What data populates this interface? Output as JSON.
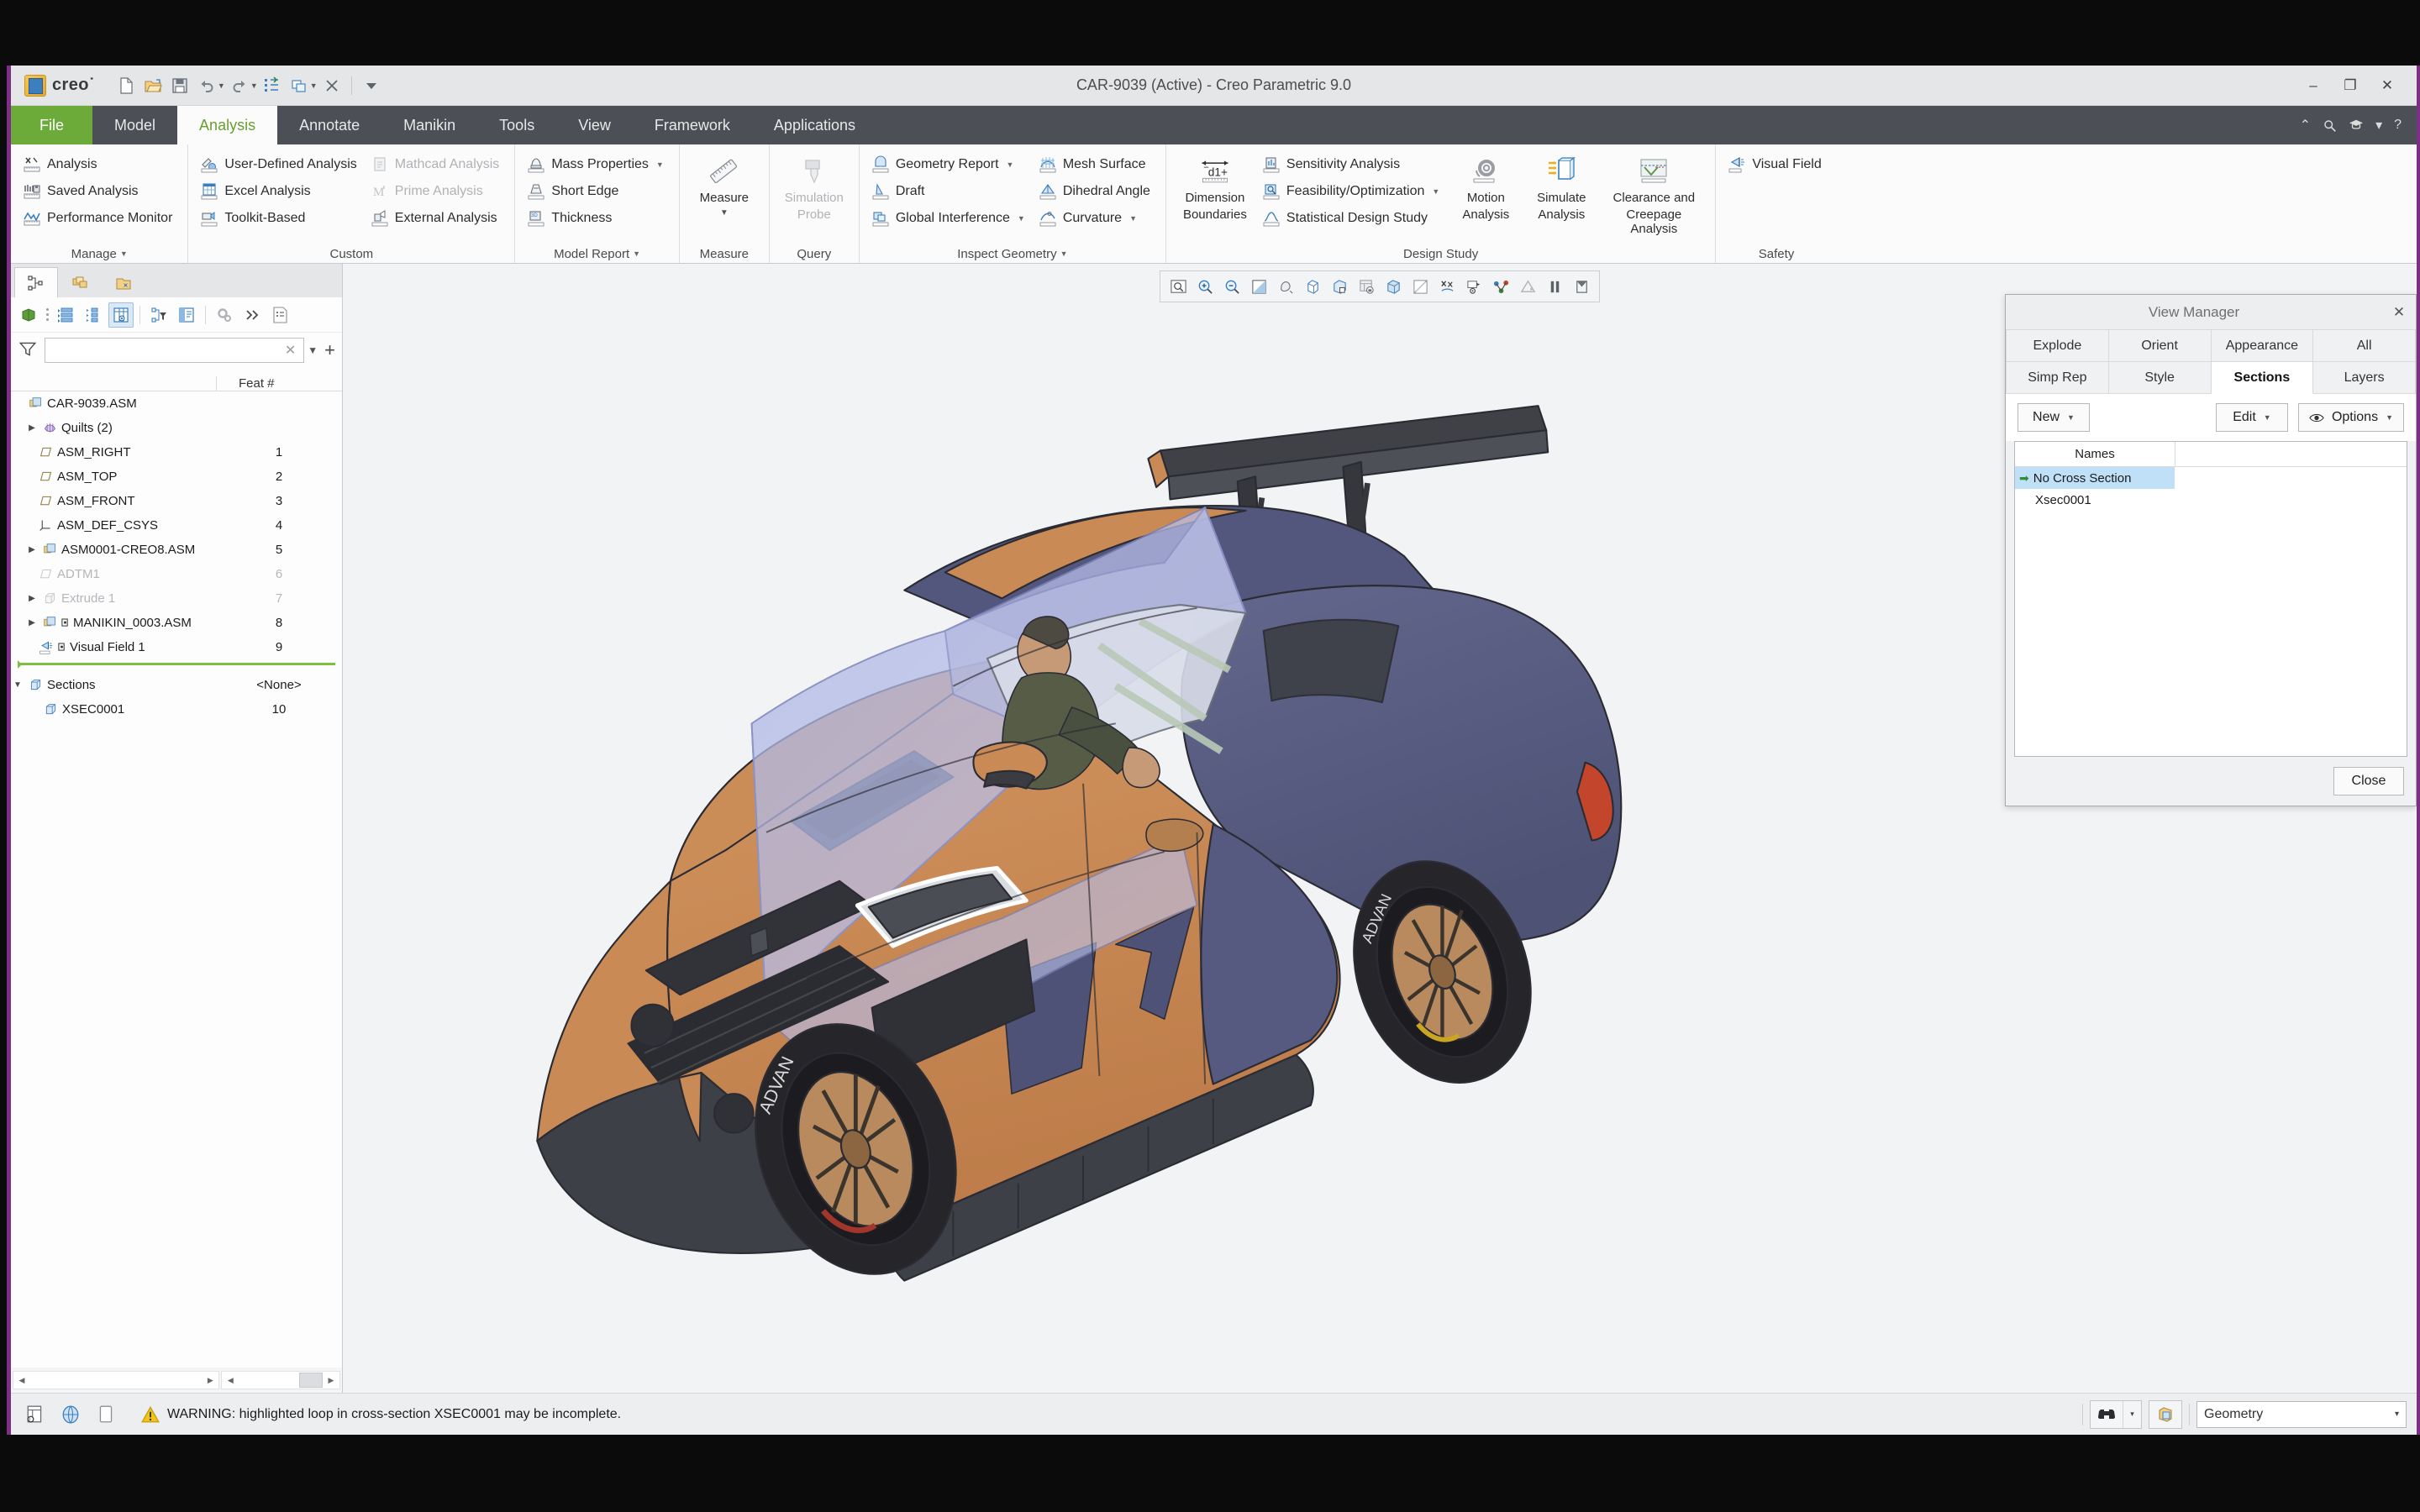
{
  "window": {
    "title": "CAR-9039 (Active) - Creo Parametric 9.0",
    "minimize": "–",
    "restore": "❐",
    "close": "✕"
  },
  "brand": {
    "name": "creo˙"
  },
  "quick_access": [
    {
      "name": "new-file-icon",
      "tip": "New"
    },
    {
      "name": "open-file-icon",
      "tip": "Open"
    },
    {
      "name": "save-icon",
      "tip": "Save"
    },
    {
      "name": "undo-icon",
      "tip": "Undo"
    },
    {
      "name": "redo-icon",
      "tip": "Redo"
    },
    {
      "name": "regenerate-icon",
      "tip": "Regenerate"
    },
    {
      "name": "window-switch-icon",
      "tip": "Switch Window"
    },
    {
      "name": "close-window-icon",
      "tip": "Close"
    },
    {
      "name": "customize-qat-icon",
      "tip": "Customize Quick Access Toolbar"
    }
  ],
  "tabs": [
    {
      "label": "File",
      "kind": "file"
    },
    {
      "label": "Model",
      "kind": "normal"
    },
    {
      "label": "Analysis",
      "kind": "active"
    },
    {
      "label": "Annotate",
      "kind": "normal"
    },
    {
      "label": "Manikin",
      "kind": "normal"
    },
    {
      "label": "Tools",
      "kind": "normal"
    },
    {
      "label": "View",
      "kind": "normal"
    },
    {
      "label": "Framework",
      "kind": "normal"
    },
    {
      "label": "Applications",
      "kind": "normal"
    }
  ],
  "tabrow_right": [
    {
      "name": "collapse-ribbon-icon",
      "glyph": "⌃"
    },
    {
      "name": "search-icon",
      "glyph": "⌕"
    },
    {
      "name": "learning-icon",
      "glyph": "🎓"
    },
    {
      "name": "learning-dropdown-icon",
      "glyph": "▾"
    },
    {
      "name": "help-icon",
      "glyph": "?"
    }
  ],
  "ribbon": {
    "groups": [
      {
        "title": "Manage",
        "has_dropdown": true,
        "items": [
          {
            "label": "Analysis",
            "icon": "analysis-icon",
            "disabled": false,
            "dropdown": false
          },
          {
            "label": "Saved Analysis",
            "icon": "saved-analysis-icon",
            "disabled": false,
            "dropdown": false
          },
          {
            "label": "Performance Monitor",
            "icon": "performance-monitor-icon",
            "disabled": false,
            "dropdown": false
          }
        ]
      },
      {
        "title": "Custom",
        "has_dropdown": false,
        "columns": [
          [
            {
              "label": "User-Defined Analysis",
              "icon": "user-defined-analysis-icon",
              "disabled": false,
              "dropdown": false
            },
            {
              "label": "Excel Analysis",
              "icon": "excel-analysis-icon",
              "disabled": false,
              "dropdown": false
            },
            {
              "label": "Toolkit-Based",
              "icon": "toolkit-based-icon",
              "disabled": false,
              "dropdown": false
            }
          ],
          [
            {
              "label": "Mathcad Analysis",
              "icon": "mathcad-analysis-icon",
              "disabled": true,
              "dropdown": false
            },
            {
              "label": "Prime Analysis",
              "icon": "prime-analysis-icon",
              "disabled": true,
              "dropdown": false
            },
            {
              "label": "External Analysis",
              "icon": "external-analysis-icon",
              "disabled": false,
              "dropdown": false
            }
          ]
        ]
      },
      {
        "title": "Model Report",
        "has_dropdown": true,
        "items": [
          {
            "label": "Mass Properties",
            "icon": "mass-properties-icon",
            "disabled": false,
            "dropdown": true
          },
          {
            "label": "Short Edge",
            "icon": "short-edge-icon",
            "disabled": false,
            "dropdown": false
          },
          {
            "label": "Thickness",
            "icon": "thickness-icon",
            "disabled": false,
            "dropdown": false
          }
        ]
      },
      {
        "title": "Measure",
        "has_dropdown": false,
        "big": [
          {
            "line1": "Measure",
            "line2": "▾",
            "icon": "measure-icon",
            "disabled": false
          }
        ]
      },
      {
        "title": "Query",
        "has_dropdown": false,
        "big": [
          {
            "line1": "Simulation",
            "line2": "Probe",
            "icon": "simulation-probe-icon",
            "disabled": true
          }
        ]
      },
      {
        "title": "Inspect Geometry",
        "has_dropdown": true,
        "columns": [
          [
            {
              "label": "Geometry Report",
              "icon": "geometry-report-icon",
              "disabled": false,
              "dropdown": true
            },
            {
              "label": "Draft",
              "icon": "draft-icon",
              "disabled": false,
              "dropdown": false
            },
            {
              "label": "Global Interference",
              "icon": "global-interference-icon",
              "disabled": false,
              "dropdown": true
            }
          ],
          [
            {
              "label": "Mesh Surface",
              "icon": "mesh-surface-icon",
              "disabled": false,
              "dropdown": false
            },
            {
              "label": "Dihedral Angle",
              "icon": "dihedral-angle-icon",
              "disabled": false,
              "dropdown": false
            },
            {
              "label": "Curvature",
              "icon": "curvature-icon",
              "disabled": false,
              "dropdown": true
            }
          ]
        ]
      },
      {
        "title": "Design Study",
        "has_dropdown": false,
        "big_left": [
          {
            "line1": "Dimension",
            "line2": "Boundaries",
            "icon": "dimension-boundaries-icon",
            "disabled": false
          }
        ],
        "items": [
          {
            "label": "Sensitivity Analysis",
            "icon": "sensitivity-analysis-icon",
            "disabled": false,
            "dropdown": false
          },
          {
            "label": "Feasibility/Optimization",
            "icon": "feasibility-optimization-icon",
            "disabled": false,
            "dropdown": true
          },
          {
            "label": "Statistical Design Study",
            "icon": "statistical-design-study-icon",
            "disabled": false,
            "dropdown": false
          }
        ],
        "big": [
          {
            "line1": "Motion",
            "line2": "Analysis",
            "icon": "motion-analysis-icon",
            "disabled": false
          },
          {
            "line1": "Simulate",
            "line2": "Analysis",
            "icon": "simulate-analysis-icon",
            "disabled": false
          },
          {
            "line1": "Clearance and",
            "line2": "Creepage Analysis",
            "icon": "clearance-creepage-icon",
            "disabled": false
          }
        ]
      },
      {
        "title": "Safety",
        "has_dropdown": false,
        "items": [
          {
            "label": "Visual Field",
            "icon": "visual-field-icon",
            "disabled": false,
            "dropdown": false
          }
        ]
      }
    ]
  },
  "tree": {
    "tabs": [
      {
        "name": "model-tree-tab",
        "selected": true
      },
      {
        "name": "layer-tree-tab",
        "selected": false
      },
      {
        "name": "folder-browser-tab",
        "selected": false
      }
    ],
    "toolbar": [
      {
        "name": "model-tree-root-icon"
      },
      {
        "name": "expand-all-icon"
      },
      {
        "name": "collapse-all-icon"
      },
      {
        "name": "tree-columns-icon"
      },
      {
        "name": "tree-filter-icon"
      },
      {
        "name": "tree-display-icon"
      },
      {
        "name": "tree-settings-icon"
      },
      {
        "name": "tree-overflow-icon"
      },
      {
        "name": "tree-report-icon"
      }
    ],
    "filter": {
      "value": "",
      "placeholder": ""
    },
    "columns": [
      "",
      "Feat #"
    ],
    "rows": [
      {
        "label": "CAR-9039.ASM",
        "feat": "",
        "icon": "assembly-icon",
        "indent": 0,
        "arrow": "none",
        "dim": false
      },
      {
        "label": "Quilts (2)",
        "feat": "",
        "icon": "quilts-icon",
        "indent": 1,
        "arrow": "collapsed",
        "dim": false
      },
      {
        "label": "ASM_RIGHT",
        "feat": "1",
        "icon": "datum-plane-icon",
        "indent": 1,
        "arrow": "none",
        "dim": false
      },
      {
        "label": "ASM_TOP",
        "feat": "2",
        "icon": "datum-plane-icon",
        "indent": 1,
        "arrow": "none",
        "dim": false
      },
      {
        "label": "ASM_FRONT",
        "feat": "3",
        "icon": "datum-plane-icon",
        "indent": 1,
        "arrow": "none",
        "dim": false
      },
      {
        "label": "ASM_DEF_CSYS",
        "feat": "4",
        "icon": "coordinate-system-icon",
        "indent": 1,
        "arrow": "none",
        "dim": false
      },
      {
        "label": "ASM0001-CREO8.ASM",
        "feat": "5",
        "icon": "assembly-icon",
        "indent": 1,
        "arrow": "collapsed",
        "dim": false
      },
      {
        "label": "ADTM1",
        "feat": "6",
        "icon": "datum-plane-icon",
        "indent": 1,
        "arrow": "none",
        "dim": true
      },
      {
        "label": "Extrude 1",
        "feat": "7",
        "icon": "extrude-icon",
        "indent": 1,
        "arrow": "collapsed",
        "dim": true
      },
      {
        "label": "MANIKIN_0003.ASM",
        "feat": "8",
        "icon": "manikin-assembly-icon",
        "indent": 1,
        "arrow": "collapsed",
        "dim": false
      },
      {
        "label": "Visual Field 1",
        "feat": "9",
        "icon": "visual-field-icon",
        "indent": 1,
        "arrow": "none",
        "dim": false
      },
      {
        "label": "__REGEN__",
        "feat": "",
        "icon": "regen-bar",
        "indent": 0,
        "arrow": "none",
        "dim": false
      },
      {
        "label": "Sections",
        "feat": "<None>",
        "icon": "sections-icon",
        "indent": 0,
        "arrow": "expanded",
        "dim": false
      },
      {
        "label": "XSEC0001",
        "feat": "10",
        "icon": "xsection-icon",
        "indent": 2,
        "arrow": "none",
        "dim": false
      }
    ]
  },
  "graphics_toolbar": [
    {
      "name": "refit-icon"
    },
    {
      "name": "zoom-in-icon"
    },
    {
      "name": "zoom-out-icon"
    },
    {
      "name": "repaint-icon"
    },
    {
      "name": "show-perspective-icon"
    },
    {
      "name": "datum-display-icon"
    },
    {
      "name": "saved-orientations-icon"
    },
    {
      "name": "view-manager-icon"
    },
    {
      "name": "display-style-icon"
    },
    {
      "name": "appearance-gallery-icon"
    },
    {
      "name": "annotation-display-icon"
    },
    {
      "name": "spin-center-icon"
    },
    {
      "name": "point-display-icon"
    },
    {
      "name": "render-icon"
    },
    {
      "name": "pause-icon"
    },
    {
      "name": "section-icon"
    }
  ],
  "view_manager": {
    "title": "View Manager",
    "close_x": "✕",
    "tabs_row1": [
      {
        "label": "Explode",
        "selected": false
      },
      {
        "label": "Orient",
        "selected": false
      },
      {
        "label": "Appearance",
        "selected": false
      },
      {
        "label": "All",
        "selected": false
      }
    ],
    "tabs_row2": [
      {
        "label": "Simp Rep",
        "selected": false
      },
      {
        "label": "Style",
        "selected": false
      },
      {
        "label": "Sections",
        "selected": true
      },
      {
        "label": "Layers",
        "selected": false
      }
    ],
    "commands": [
      {
        "label": "New",
        "dropdown": true,
        "icon": null
      },
      {
        "label": "Edit",
        "dropdown": true,
        "icon": null
      },
      {
        "label": "Options",
        "dropdown": true,
        "icon": "eye-icon"
      }
    ],
    "list_header": "Names",
    "list": [
      {
        "label": "No Cross Section",
        "selected": true,
        "marker": "➡"
      },
      {
        "label": "Xsec0001",
        "selected": false,
        "marker": ""
      }
    ],
    "close_button": "Close"
  },
  "status": {
    "left_icons": [
      {
        "name": "model-info-icon"
      },
      {
        "name": "web-browser-icon"
      },
      {
        "name": "notes-panel-icon"
      }
    ],
    "warning_icon": "warning-triangle-icon",
    "message": "WARNING: highlighted loop in cross-section XSEC0001 may be incomplete.",
    "right": {
      "search_icon": "binoculars-icon",
      "search_dropdown": "▾",
      "selection_icon": "selection-filter-icon",
      "filter_value": "Geometry",
      "filter_dropdown": "▾"
    }
  },
  "model_colors": {
    "body_orange": "#c98a55",
    "body_navy": "#5b5f84",
    "glass_blue": "#aab2de",
    "dark_trim": "#3a3c42",
    "taillight": "#c2452c",
    "viewport_bg": "#f2f3f5",
    "wheel_bronze": "#b98a5e",
    "tire_black": "#2c2c30",
    "interior_green": "#5c6147"
  }
}
